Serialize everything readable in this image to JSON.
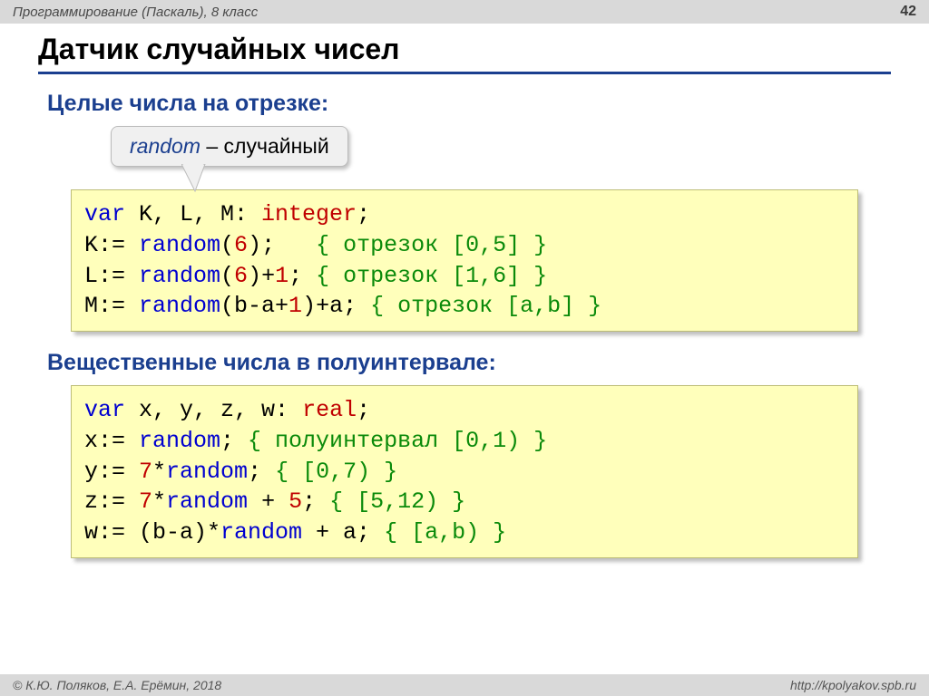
{
  "header": {
    "course": "Программирование (Паскаль), 8 класс",
    "page": "42"
  },
  "title": "Датчик случайных чисел",
  "section1_title": "Целые числа на отрезке:",
  "callout": {
    "word": "random",
    "dash": " – случайный"
  },
  "code1": {
    "l1": {
      "a": "var",
      "b": " K, L, M: ",
      "c": "integer",
      "d": ";"
    },
    "l2": {
      "a": "K:= ",
      "b": "random",
      "c": "(",
      "d": "6",
      "e": ");   ",
      "f": "{ отрезок [0,5] }"
    },
    "l3": {
      "a": "L:= ",
      "b": "random",
      "c": "(",
      "d": "6",
      "e": ")+",
      "f": "1",
      "g": "; ",
      "h": "{ отрезок [1,6] }"
    },
    "l4": {
      "a": "M:= ",
      "b": "random",
      "c": "(b-a+",
      "d": "1",
      "e": ")+a; ",
      "f": "{ отрезок [a,b] }"
    }
  },
  "section2_title": "Вещественные числа в полуинтервале:",
  "code2": {
    "l1": {
      "a": "var",
      "b": " x, y, z, w: ",
      "c": "real",
      "d": ";"
    },
    "l2": {
      "a": "x:= ",
      "b": "random",
      "c": "; ",
      "d": "{ полуинтервал [0,1) }"
    },
    "l3": {
      "a": "y:= ",
      "b": "7",
      "c": "*",
      "d": "random",
      "e": "; ",
      "f": "{ [0,7) }"
    },
    "l4": {
      "a": "z:= ",
      "b": "7",
      "c": "*",
      "d": "random",
      "e": " + ",
      "f": "5",
      "g": "; ",
      "h": "{ [5,12) }"
    },
    "l5": {
      "a": "w:= (b-a)*",
      "b": "random",
      "c": " + a; ",
      "d": "{ [a,b) }"
    }
  },
  "footer": {
    "copyright": "© К.Ю. Поляков, Е.А. Ерёмин, 2018",
    "url": "http://kpolyakov.spb.ru"
  }
}
